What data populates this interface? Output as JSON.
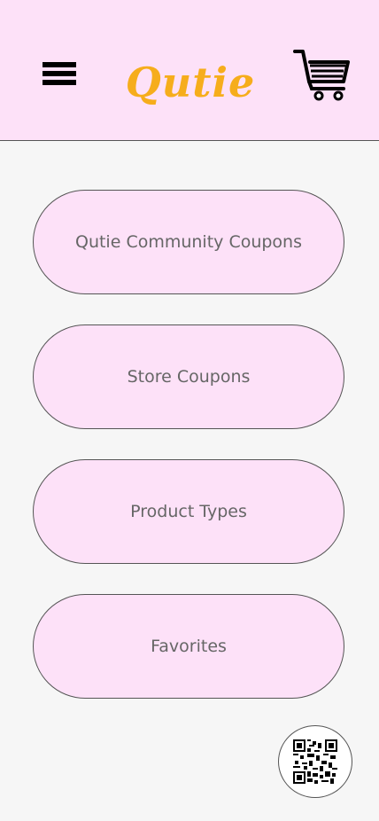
{
  "header": {
    "menu_icon": "hamburger-menu-icon",
    "logo_text": "Qutie",
    "cart_icon": "shopping-cart-icon",
    "background_color": "#fde1f8",
    "logo_color": "#f6ad1c"
  },
  "main": {
    "buttons": [
      {
        "label": "Qutie Community Coupons"
      },
      {
        "label": "Store Coupons"
      },
      {
        "label": "Product Types"
      },
      {
        "label": "Favorites"
      }
    ],
    "qr_button_icon": "qr-code-icon"
  }
}
